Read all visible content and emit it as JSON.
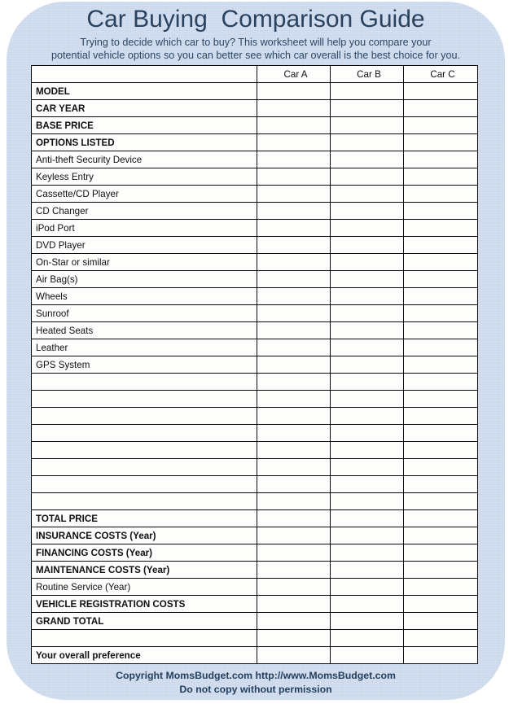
{
  "header": {
    "title": "Car Buying  Comparison Guide",
    "subtitle": "Trying to decide which car to buy?  This worksheet will help you compare your\npotential vehicle options so you can better see which car overall is the best choice for you."
  },
  "table": {
    "columns": [
      "",
      "Car A",
      "Car B",
      "Car C"
    ],
    "rows": [
      {
        "label": "MODEL",
        "style": "bold"
      },
      {
        "label": "CAR YEAR",
        "style": "bold"
      },
      {
        "label": "BASE PRICE",
        "style": "bold"
      },
      {
        "label": "OPTIONS LISTED",
        "style": "bold"
      },
      {
        "label": "Anti-theft Security Device",
        "style": "plain"
      },
      {
        "label": "Keyless Entry",
        "style": "plain"
      },
      {
        "label": "Cassette/CD Player",
        "style": "plain"
      },
      {
        "label": "CD Changer",
        "style": "plain"
      },
      {
        "label": "iPod Port",
        "style": "plain"
      },
      {
        "label": "DVD Player",
        "style": "plain"
      },
      {
        "label": "On-Star or similar",
        "style": "plain"
      },
      {
        "label": "Air Bag(s)",
        "style": "plain"
      },
      {
        "label": "Wheels",
        "style": "plain"
      },
      {
        "label": "Sunroof",
        "style": "plain"
      },
      {
        "label": "Heated Seats",
        "style": "plain"
      },
      {
        "label": "Leather",
        "style": "plain"
      },
      {
        "label": "GPS System",
        "style": "plain"
      },
      {
        "label": "",
        "style": "plain"
      },
      {
        "label": "",
        "style": "plain"
      },
      {
        "label": "",
        "style": "plain"
      },
      {
        "label": "",
        "style": "plain"
      },
      {
        "label": "",
        "style": "plain"
      },
      {
        "label": "",
        "style": "plain"
      },
      {
        "label": "",
        "style": "plain"
      },
      {
        "label": "",
        "style": "plain"
      },
      {
        "label": "TOTAL PRICE",
        "style": "bold"
      },
      {
        "label": "INSURANCE COSTS (Year)",
        "style": "bold"
      },
      {
        "label": "FINANCING COSTS (Year)",
        "style": "bold"
      },
      {
        "label": "MAINTENANCE COSTS (Year)",
        "style": "bold"
      },
      {
        "label": "Routine Service (Year)",
        "style": "plain"
      },
      {
        "label": "VEHICLE REGISTRATION COSTS",
        "style": "bold"
      },
      {
        "label": "GRAND TOTAL",
        "style": "blue"
      },
      {
        "label": "",
        "style": "spacer"
      },
      {
        "label": "Your overall preference",
        "style": "pref"
      }
    ],
    "cell_values": {
      "car_a": "",
      "car_b": "",
      "car_c": ""
    }
  },
  "footer": {
    "line1": "Copyright MomsBudget.com  http://www.MomsBudget.com",
    "line2": "Do not copy without permission"
  }
}
